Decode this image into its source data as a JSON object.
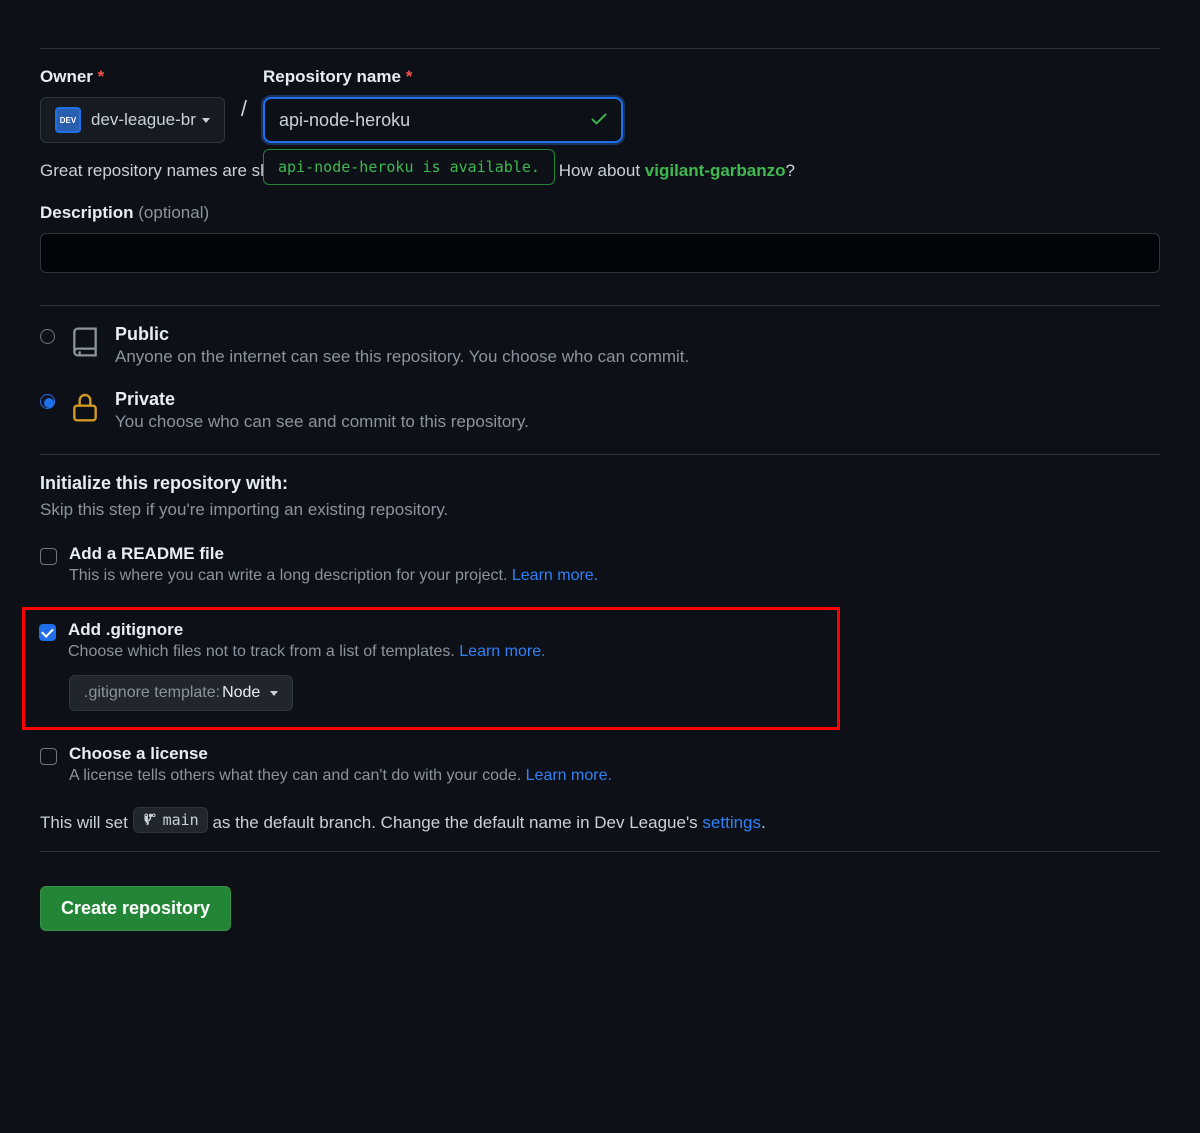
{
  "owner": {
    "label": "Owner",
    "value": "dev-league-br"
  },
  "repo": {
    "label": "Repository name",
    "value": "api-node-heroku",
    "availability": "api-node-heroku is available."
  },
  "helper": {
    "prefix": "Great repository names are sh",
    "mid": "spiration? How about ",
    "suggestion": "vigilant-garbanzo",
    "suffix": "?"
  },
  "description": {
    "label": "Description",
    "optional": "(optional)"
  },
  "visibility": {
    "public": {
      "title": "Public",
      "desc": "Anyone on the internet can see this repository. You choose who can commit."
    },
    "private": {
      "title": "Private",
      "desc": "You choose who can see and commit to this repository."
    }
  },
  "init": {
    "heading": "Initialize this repository with:",
    "sub": "Skip this step if you're importing an existing repository.",
    "readme": {
      "title": "Add a README file",
      "desc": "This is where you can write a long description for your project. ",
      "learn": "Learn more."
    },
    "gitignore": {
      "title": "Add .gitignore",
      "desc": "Choose which files not to track from a list of templates. ",
      "learn": "Learn more.",
      "template_label": ".gitignore template:",
      "template_value": "Node"
    },
    "license": {
      "title": "Choose a license",
      "desc": "A license tells others what they can and can't do with your code. ",
      "learn": "Learn more."
    }
  },
  "branch": {
    "prefix": "This will set ",
    "name": "main",
    "mid": " as the default branch. Change the default name in Dev League's ",
    "settings": "settings",
    "suffix": "."
  },
  "buttons": {
    "create": "Create repository"
  }
}
